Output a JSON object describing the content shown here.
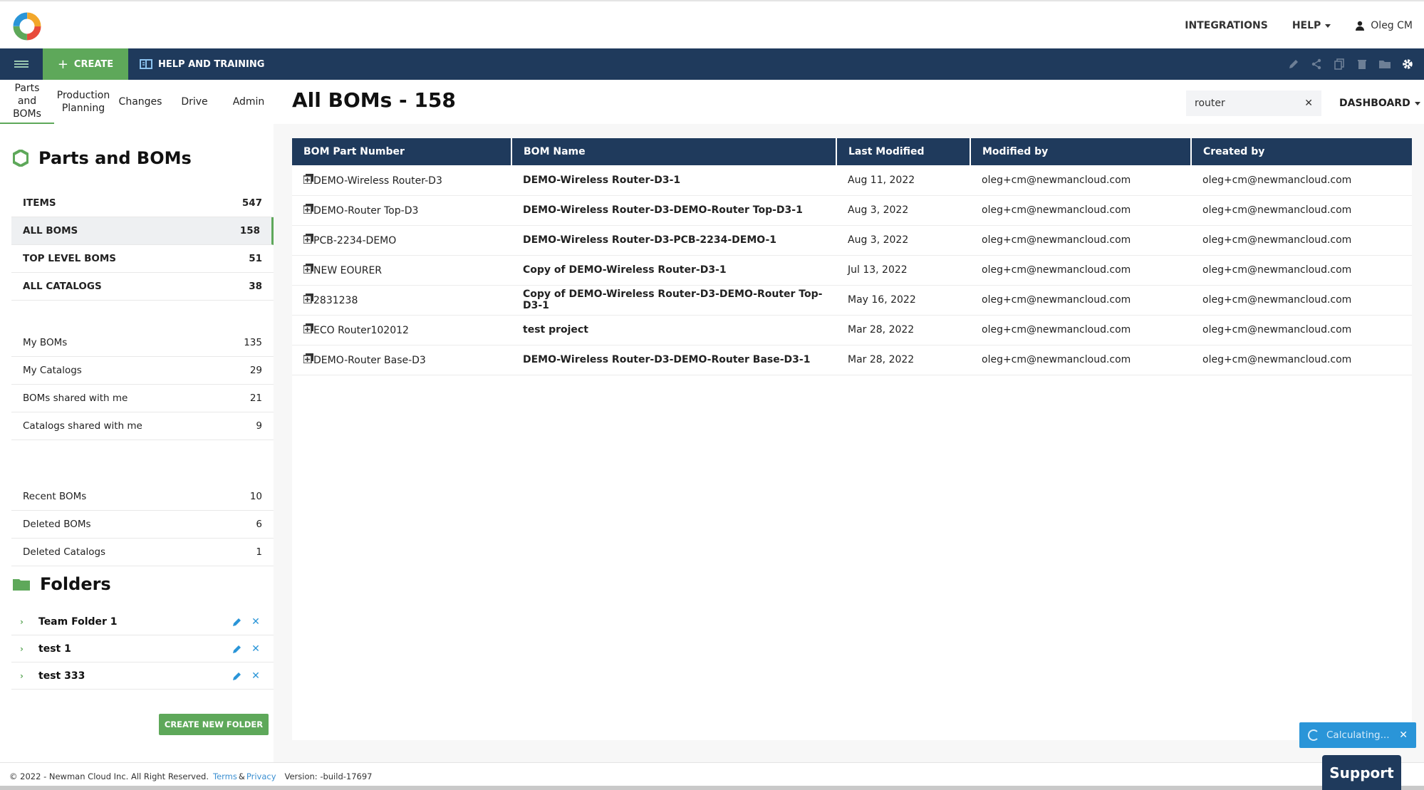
{
  "header": {
    "integrations_label": "INTEGRATIONS",
    "help_label": "HELP",
    "user_name": "Oleg CM"
  },
  "navbar": {
    "create_label": "CREATE",
    "help_training_label": "HELP AND TRAINING",
    "tool_icons": [
      "edit-icon",
      "share-icon",
      "copy-icon",
      "trash-icon",
      "folder-move-icon",
      "gear-icon"
    ]
  },
  "subtabs": [
    {
      "label_line1": "Parts and",
      "label_line2": "BOMs"
    },
    {
      "label_line1": "Production",
      "label_line2": "Planning"
    },
    {
      "label_line1": "Changes",
      "label_line2": ""
    },
    {
      "label_line1": "Drive",
      "label_line2": ""
    },
    {
      "label_line1": "Admin",
      "label_line2": ""
    }
  ],
  "main": {
    "title": "All BOMs - 158",
    "search_value": "router",
    "dashboard_label": "DASHBOARD",
    "columns": [
      "BOM Part Number",
      "BOM Name",
      "Last Modified",
      "Modified by",
      "Created by"
    ],
    "rows": [
      {
        "part": "DEMO-Wireless Router-D3",
        "name": "DEMO-Wireless Router-D3-1",
        "modified": "Aug 11, 2022",
        "modified_by": "oleg+cm@newmancloud.com",
        "created_by": "oleg+cm@newmancloud.com"
      },
      {
        "part": "DEMO-Router Top-D3",
        "name": "DEMO-Wireless Router-D3-DEMO-Router Top-D3-1",
        "modified": "Aug 3, 2022",
        "modified_by": "oleg+cm@newmancloud.com",
        "created_by": "oleg+cm@newmancloud.com"
      },
      {
        "part": "PCB-2234-DEMO",
        "name": "DEMO-Wireless Router-D3-PCB-2234-DEMO-1",
        "modified": "Aug 3, 2022",
        "modified_by": "oleg+cm@newmancloud.com",
        "created_by": "oleg+cm@newmancloud.com"
      },
      {
        "part": "NEW EOURER",
        "name": "Copy of DEMO-Wireless Router-D3-1",
        "modified": "Jul 13, 2022",
        "modified_by": "oleg+cm@newmancloud.com",
        "created_by": "oleg+cm@newmancloud.com"
      },
      {
        "part": "2831238",
        "name": "Copy of DEMO-Wireless Router-D3-DEMO-Router Top-D3-1",
        "modified": "May 16, 2022",
        "modified_by": "oleg+cm@newmancloud.com",
        "created_by": "oleg+cm@newmancloud.com"
      },
      {
        "part": "ECO Router102012",
        "name": "test project",
        "modified": "Mar 28, 2022",
        "modified_by": "oleg+cm@newmancloud.com",
        "created_by": "oleg+cm@newmancloud.com"
      },
      {
        "part": "DEMO-Router Base-D3",
        "name": "DEMO-Wireless Router-D3-DEMO-Router Base-D3-1",
        "modified": "Mar 28, 2022",
        "modified_by": "oleg+cm@newmancloud.com",
        "created_by": "oleg+cm@newmancloud.com"
      }
    ]
  },
  "sidebar": {
    "title": "Parts and BOMs",
    "group1": [
      {
        "label": "ITEMS",
        "count": "547"
      },
      {
        "label": "ALL BOMS",
        "count": "158"
      },
      {
        "label": "TOP LEVEL BOMS",
        "count": "51"
      },
      {
        "label": "ALL CATALOGS",
        "count": "38"
      }
    ],
    "group2": [
      {
        "label": "My BOMs",
        "count": "135"
      },
      {
        "label": "My Catalogs",
        "count": "29"
      },
      {
        "label": "BOMs shared with me",
        "count": "21"
      },
      {
        "label": "Catalogs shared with me",
        "count": "9"
      }
    ],
    "group3": [
      {
        "label": "Recent BOMs",
        "count": "10"
      },
      {
        "label": "Deleted BOMs",
        "count": "6"
      },
      {
        "label": "Deleted Catalogs",
        "count": "1"
      }
    ],
    "folders_title": "Folders",
    "folders": [
      {
        "name": "Team Folder 1"
      },
      {
        "name": "test 1"
      },
      {
        "name": "test 333"
      }
    ],
    "create_folder_label": "CREATE NEW FOLDER"
  },
  "status": {
    "calculating_label": "Calculating..."
  },
  "footer": {
    "copyright": "© 2022 - Newman Cloud Inc. All Right Reserved.",
    "terms": "Terms",
    "amp": "&",
    "privacy": "Privacy",
    "version": "Version: -build-17697",
    "support_label": "Support"
  },
  "colors": {
    "navy": "#1f3a5c",
    "green": "#5ea85a",
    "blue": "#2a95d8"
  }
}
